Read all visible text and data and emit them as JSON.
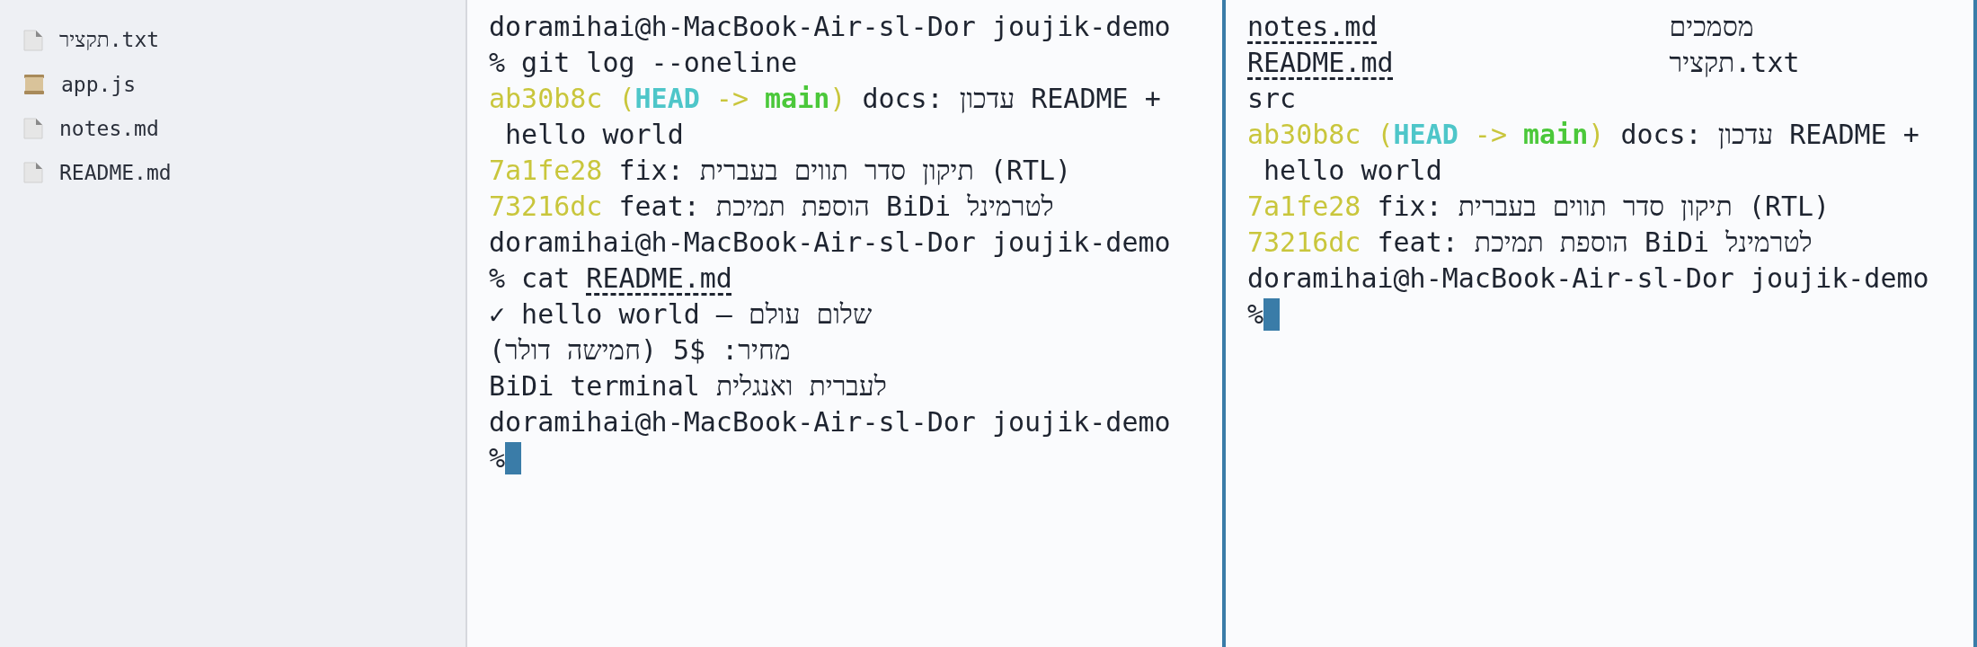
{
  "sidebar": {
    "items": [
      {
        "name": "תקציר.txt",
        "kind": "document"
      },
      {
        "name": "app.js",
        "kind": "script"
      },
      {
        "name": "notes.md",
        "kind": "document"
      },
      {
        "name": "README.md",
        "kind": "document"
      }
    ]
  },
  "left_pane": {
    "focused": false,
    "lines": [
      {
        "kind": "text",
        "text": "doramihai@h-MacBook-Air-sl-Dor joujik-demo"
      },
      {
        "kind": "text",
        "text": "% git log --oneline"
      },
      {
        "kind": "commit",
        "hash": "ab30b8c",
        "decoration": {
          "open": "(",
          "head": "HEAD",
          "arrow": "->",
          "branch": "main",
          "close": ")"
        },
        "message": "docs: עדכון README +"
      },
      {
        "kind": "text",
        "wrapped": true,
        "text": "hello world"
      },
      {
        "kind": "commit",
        "hash": "7a1fe28",
        "message": "fix: תיקון סדר תווים בעברית (RTL)"
      },
      {
        "kind": "commit",
        "hash": "73216dc",
        "message": "feat: הוספת תמיכת BiDi לטרמינל"
      },
      {
        "kind": "text",
        "text": "doramihai@h-MacBook-Air-sl-Dor joujik-demo"
      },
      {
        "kind": "command",
        "command": "% cat",
        "file": "README.md"
      },
      {
        "kind": "text",
        "text": "✓ hello world — שלום עולם"
      },
      {
        "kind": "text",
        "text": "מחיר: 5$ (חמישה דולר)"
      },
      {
        "kind": "text",
        "text": "BiDi terminal לעברית ואנגלית"
      },
      {
        "kind": "text",
        "text": "doramihai@h-MacBook-Air-sl-Dor joujik-demo"
      },
      {
        "kind": "text",
        "cursor": true,
        "text": "%"
      }
    ]
  },
  "right_pane": {
    "focused": true,
    "lines": [
      {
        "kind": "ls",
        "column_1": "notes.md",
        "column_2": "מסמכים"
      },
      {
        "kind": "ls",
        "column_1": "README.md",
        "column_2": "תקציר.txt"
      },
      {
        "kind": "text",
        "text": "src"
      },
      {
        "kind": "commit",
        "hash": "ab30b8c",
        "decoration": {
          "open": "(",
          "head": "HEAD",
          "arrow": "->",
          "branch": "main",
          "close": ")"
        },
        "message": "docs: עדכון README +"
      },
      {
        "kind": "text",
        "wrapped": true,
        "text": "hello world"
      },
      {
        "kind": "commit",
        "hash": "7a1fe28",
        "message": "fix: תיקון סדר תווים בעברית (RTL)"
      },
      {
        "kind": "commit",
        "hash": "73216dc",
        "message": "feat: הוספת תמיכת BiDi לטרמינל"
      },
      {
        "kind": "text",
        "text": "doramihai@h-MacBook-Air-sl-Dor joujik-demo"
      },
      {
        "kind": "text",
        "cursor": true,
        "text": "%"
      }
    ]
  }
}
